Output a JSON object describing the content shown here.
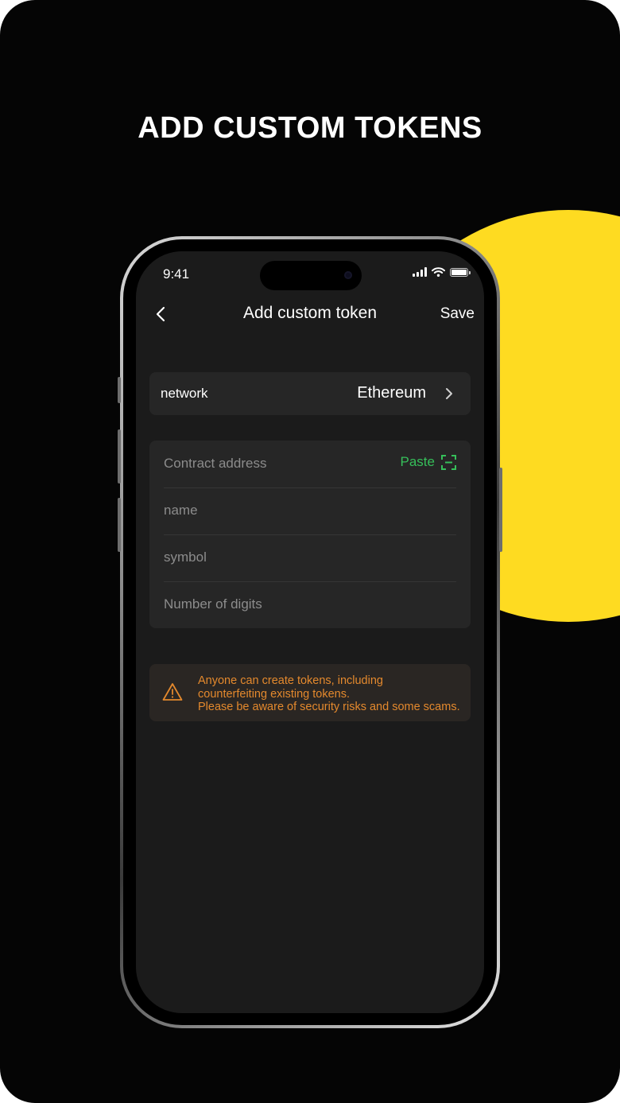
{
  "headline": "ADD CUSTOM TOKENS",
  "status_bar": {
    "time": "9:41"
  },
  "nav": {
    "title": "Add custom token",
    "save_label": "Save"
  },
  "network": {
    "label": "network",
    "value": "Ethereum"
  },
  "form": {
    "contract_address_placeholder": "Contract address",
    "paste_label": "Paste",
    "name_placeholder": "name",
    "symbol_placeholder": "symbol",
    "digits_placeholder": "Number of digits"
  },
  "warning": {
    "line1": "Anyone can create tokens, including",
    "line2": "counterfeiting existing tokens.",
    "line3": "Please be aware of security risks and some scams."
  },
  "colors": {
    "background": "#050505",
    "accent_yellow": "#fedb21",
    "paste_green": "#36bf5a",
    "warning_orange": "#e4892d"
  },
  "icons": [
    "back-chevron-icon",
    "chevron-right-icon",
    "scan-icon",
    "warning-triangle-icon",
    "signal-icon",
    "wifi-icon",
    "battery-icon"
  ]
}
